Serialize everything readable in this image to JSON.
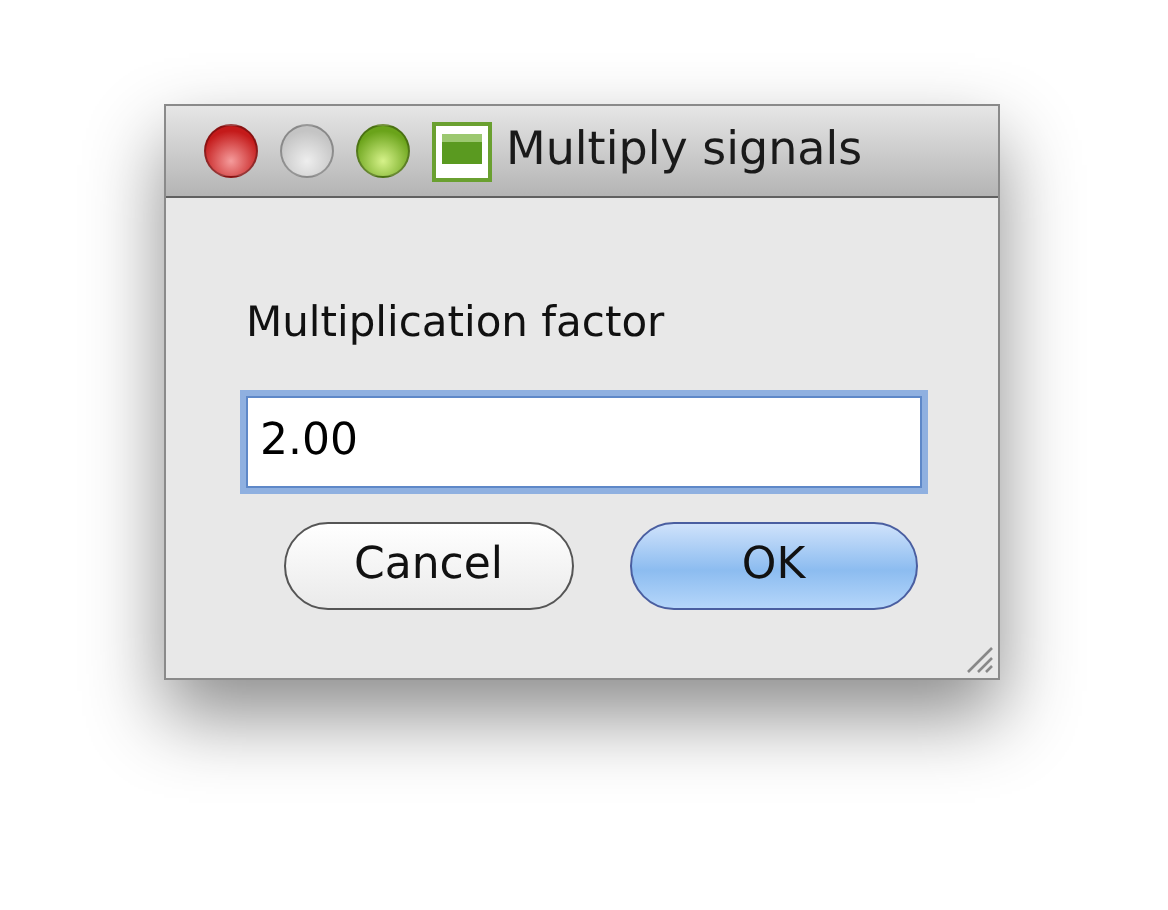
{
  "window": {
    "title": "Multiply signals",
    "controls": [
      {
        "kind": "close",
        "disabled": false
      },
      {
        "kind": "minimize",
        "disabled": true
      },
      {
        "kind": "zoom",
        "disabled": false
      }
    ]
  },
  "label": "Multiplication factor",
  "field": {
    "value": "2.00",
    "focused": true
  },
  "buttons": [
    {
      "label": "Cancel",
      "default": false
    },
    {
      "label": "OK",
      "default": true
    }
  ]
}
